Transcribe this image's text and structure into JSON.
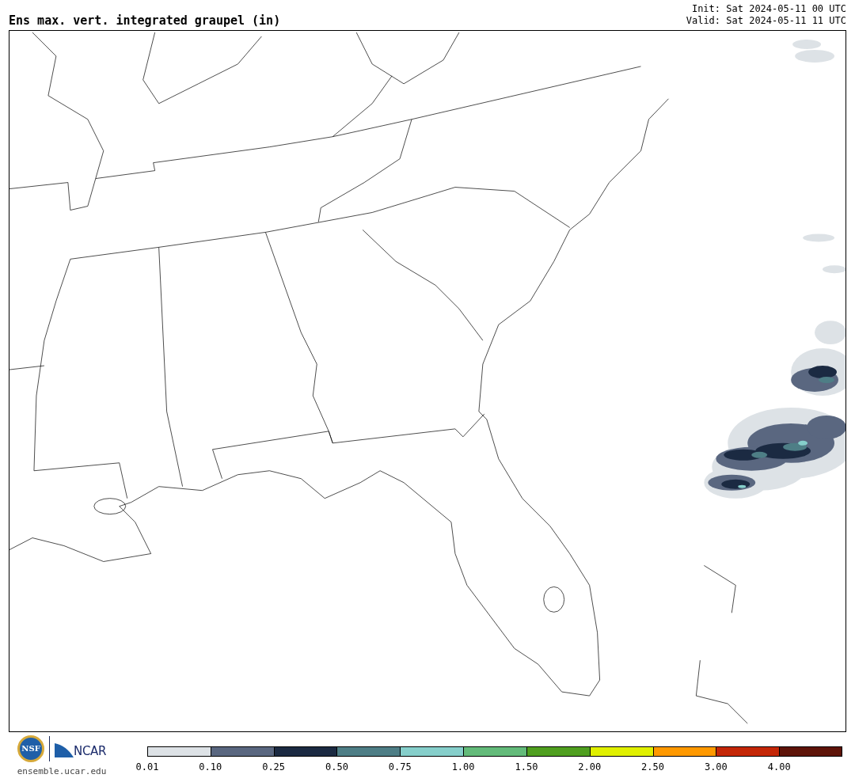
{
  "header": {
    "title": "Ens max. vert. integrated graupel (in)",
    "init": "Init: Sat 2024-05-11 00 UTC",
    "valid": "Valid: Sat 2024-05-11 11 UTC"
  },
  "footer": {
    "nsf_logo": "NSF",
    "ncar_logo": "NCAR",
    "url": "ensemble.ucar.edu"
  },
  "colorbar": {
    "bins": [
      {
        "label": "0.01",
        "color": "#dde2e6"
      },
      {
        "label": "0.10",
        "color": "#5a6780"
      },
      {
        "label": "0.25",
        "color": "#1b2a42"
      },
      {
        "label": "0.50",
        "color": "#4e7e86"
      },
      {
        "label": "0.75",
        "color": "#86cfcb"
      },
      {
        "label": "1.00",
        "color": "#63bb7a"
      },
      {
        "label": "1.50",
        "color": "#4f9f1f"
      },
      {
        "label": "2.00",
        "color": "#e0f000"
      },
      {
        "label": "2.50",
        "color": "#ff9900"
      },
      {
        "label": "3.00",
        "color": "#c42707"
      },
      {
        "label": "4.00",
        "color": "#5e1409"
      }
    ]
  }
}
